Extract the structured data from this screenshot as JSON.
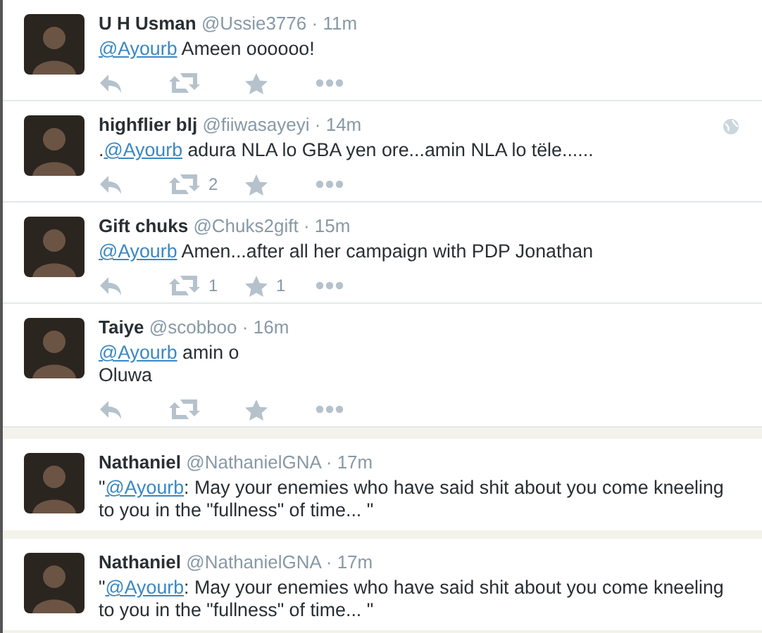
{
  "tweets": [
    {
      "name": "U H Usman",
      "handle": "@Ussie3776",
      "separator": "·",
      "time": "11m",
      "mention": "@Ayourb",
      "text": " Ameen oooooo!",
      "globe": false,
      "kind": "timeline",
      "actions": [
        {
          "kind": "reply"
        },
        {
          "kind": "retweet"
        },
        {
          "kind": "favorite"
        },
        {
          "kind": "more"
        }
      ]
    },
    {
      "name": "highflier blj",
      "handle": "@fiiwasayeyi",
      "separator": "·",
      "time": "14m",
      "prefix": ".",
      "mention": "@Ayourb",
      "text": " adura NLA lo GBA yen ore...amin NLA lo tële......",
      "globe": true,
      "kind": "timeline",
      "actions": [
        {
          "kind": "reply"
        },
        {
          "kind": "retweet",
          "count": "2"
        },
        {
          "kind": "favorite"
        },
        {
          "kind": "more"
        }
      ]
    },
    {
      "name": "Gift chuks",
      "handle": "@Chuks2gift",
      "separator": "·",
      "time": "15m",
      "mention": "@Ayourb",
      "text": "  Amen...after all her campaign with PDP Jonathan",
      "globe": false,
      "kind": "timeline",
      "actions": [
        {
          "kind": "reply"
        },
        {
          "kind": "retweet",
          "count": "1"
        },
        {
          "kind": "favorite",
          "count": "1"
        },
        {
          "kind": "more"
        }
      ]
    },
    {
      "name": "Taiye",
      "handle": "@scobboo",
      "separator": "·",
      "time": "16m",
      "mention": "@Ayourb",
      "text": " amin o\nOluwa",
      "globe": false,
      "kind": "timeline",
      "actions": [
        {
          "kind": "reply"
        },
        {
          "kind": "retweet"
        },
        {
          "kind": "favorite"
        },
        {
          "kind": "more"
        }
      ]
    },
    {
      "name": "Nathaniel",
      "handle": "@NathanielGNA",
      "separator": "·",
      "time": "17m",
      "prefix": "\"",
      "mention": "@Ayourb",
      "text": ": May your enemies who have said shit about you come kneeling to you in the \"fullness\" of time... \"",
      "globe": false,
      "kind": "card"
    },
    {
      "name": "Nathaniel",
      "handle": "@NathanielGNA",
      "separator": "·",
      "time": "17m",
      "prefix": "\"",
      "mention": "@Ayourb",
      "text": ": May your enemies who have said shit about you come kneeling to you in the \"fullness\" of time... \"",
      "globe": false,
      "kind": "card"
    }
  ]
}
